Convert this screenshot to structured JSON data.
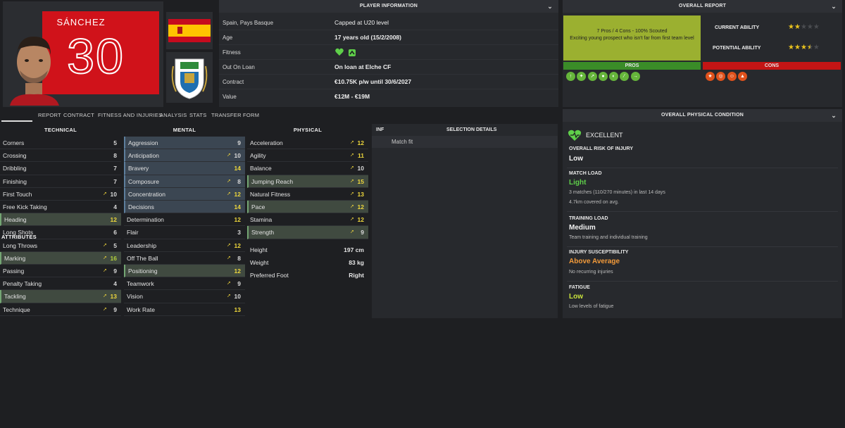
{
  "player": {
    "name": "SÁNCHEZ",
    "number": "30"
  },
  "info": {
    "title": "PLAYER INFORMATION",
    "rows": [
      {
        "key": "Spain, Pays Basque",
        "value": "Capped at U20 level",
        "bold": false
      },
      {
        "key": "Age",
        "value": "17 years old (15/2/2008)",
        "bold": true
      },
      {
        "key": "Fitness",
        "value": "",
        "bold": false
      },
      {
        "key": "Out On Loan",
        "value": "On loan at Elche CF",
        "bold": true
      },
      {
        "key": "Contract",
        "value": "€10.75K p/w until 30/6/2027",
        "bold": true
      },
      {
        "key": "Value",
        "value": "€12M - €19M",
        "bold": true
      }
    ]
  },
  "tabs": [
    "ATTRIBUTES",
    "REPORT",
    "CONTRACT",
    "FITNESS AND INJURIES",
    "ANALYSIS",
    "STATS",
    "TRANSFER",
    "FORM"
  ],
  "attributes": {
    "technical": {
      "title": "TECHNICAL",
      "rows": [
        {
          "n": "Corners",
          "v": "5",
          "arrow": false,
          "hl": "",
          "c": "w"
        },
        {
          "n": "Crossing",
          "v": "8",
          "arrow": false,
          "hl": "",
          "c": "w"
        },
        {
          "n": "Dribbling",
          "v": "7",
          "arrow": false,
          "hl": "",
          "c": "w"
        },
        {
          "n": "Finishing",
          "v": "7",
          "arrow": false,
          "hl": "",
          "c": "w"
        },
        {
          "n": "First Touch",
          "v": "10",
          "arrow": true,
          "hl": "",
          "c": "w"
        },
        {
          "n": "Free Kick Taking",
          "v": "4",
          "arrow": false,
          "hl": "",
          "c": "w"
        },
        {
          "n": "Heading",
          "v": "12",
          "arrow": false,
          "hl": "g",
          "c": "y"
        },
        {
          "n": "Long Shots",
          "v": "6",
          "arrow": false,
          "hl": "",
          "c": "w"
        },
        {
          "n": "Long Throws",
          "v": "5",
          "arrow": true,
          "hl": "",
          "c": "w"
        },
        {
          "n": "Marking",
          "v": "16",
          "arrow": true,
          "hl": "g",
          "c": "g"
        },
        {
          "n": "Passing",
          "v": "9",
          "arrow": true,
          "hl": "",
          "c": "w"
        },
        {
          "n": "Penalty Taking",
          "v": "4",
          "arrow": false,
          "hl": "",
          "c": "w"
        },
        {
          "n": "Tackling",
          "v": "13",
          "arrow": true,
          "hl": "g",
          "c": "y"
        },
        {
          "n": "Technique",
          "v": "9",
          "arrow": true,
          "hl": "",
          "c": "w"
        }
      ]
    },
    "mental": {
      "title": "MENTAL",
      "rows": [
        {
          "n": "Aggression",
          "v": "9",
          "arrow": false,
          "hl": "b",
          "c": "w"
        },
        {
          "n": "Anticipation",
          "v": "10",
          "arrow": true,
          "hl": "b",
          "c": "w"
        },
        {
          "n": "Bravery",
          "v": "14",
          "arrow": false,
          "hl": "b",
          "c": "y"
        },
        {
          "n": "Composure",
          "v": "8",
          "arrow": true,
          "hl": "b",
          "c": "w"
        },
        {
          "n": "Concentration",
          "v": "12",
          "arrow": true,
          "hl": "b",
          "c": "y"
        },
        {
          "n": "Decisions",
          "v": "14",
          "arrow": false,
          "hl": "b",
          "c": "y"
        },
        {
          "n": "Determination",
          "v": "12",
          "arrow": false,
          "hl": "",
          "c": "y"
        },
        {
          "n": "Flair",
          "v": "3",
          "arrow": false,
          "hl": "",
          "c": "w"
        },
        {
          "n": "Leadership",
          "v": "12",
          "arrow": true,
          "hl": "",
          "c": "y"
        },
        {
          "n": "Off The Ball",
          "v": "8",
          "arrow": true,
          "hl": "",
          "c": "w"
        },
        {
          "n": "Positioning",
          "v": "12",
          "arrow": false,
          "hl": "g",
          "c": "y"
        },
        {
          "n": "Teamwork",
          "v": "9",
          "arrow": true,
          "hl": "",
          "c": "w"
        },
        {
          "n": "Vision",
          "v": "10",
          "arrow": true,
          "hl": "",
          "c": "w"
        },
        {
          "n": "Work Rate",
          "v": "13",
          "arrow": false,
          "hl": "",
          "c": "y"
        }
      ]
    },
    "physical": {
      "title": "PHYSICAL",
      "rows": [
        {
          "n": "Acceleration",
          "v": "12",
          "arrow": true,
          "hl": "",
          "c": "y"
        },
        {
          "n": "Agility",
          "v": "11",
          "arrow": true,
          "hl": "",
          "c": "y"
        },
        {
          "n": "Balance",
          "v": "10",
          "arrow": true,
          "hl": "",
          "c": "w"
        },
        {
          "n": "Jumping Reach",
          "v": "15",
          "arrow": true,
          "hl": "g",
          "c": "y"
        },
        {
          "n": "Natural Fitness",
          "v": "13",
          "arrow": true,
          "hl": "",
          "c": "y"
        },
        {
          "n": "Pace",
          "v": "12",
          "arrow": true,
          "hl": "g",
          "c": "y"
        },
        {
          "n": "Stamina",
          "v": "12",
          "arrow": true,
          "hl": "",
          "c": "y"
        },
        {
          "n": "Strength",
          "v": "9",
          "arrow": true,
          "hl": "g",
          "c": "w"
        }
      ]
    },
    "physical_info": [
      {
        "n": "Height",
        "v": "197 cm"
      },
      {
        "n": "Weight",
        "v": "83 kg"
      },
      {
        "n": "Preferred Foot",
        "v": "Right"
      }
    ]
  },
  "selection": {
    "inf": "INF",
    "title": "SELECTION DETAILS",
    "match_fit": "Match fit"
  },
  "report": {
    "title": "OVERALL REPORT",
    "scout_line1": "7 Pros / 4 Cons - 100% Scouted",
    "scout_line2": "Exciting young prospect who isn't far from first team level",
    "current_ability": "CURRENT ABILITY",
    "potential_ability": "POTENTIAL ABILITY",
    "ca_stars": 2,
    "pa_stars": 3.5,
    "pros": "PROS",
    "cons": "CONS",
    "pros_count": 7,
    "cons_count": 4
  },
  "condition": {
    "title": "OVERALL PHYSICAL CONDITION",
    "status": "EXCELLENT",
    "risk_title": "OVERALL RISK OF INJURY",
    "risk_value": "Low",
    "load_title": "MATCH LOAD",
    "load_value": "Light",
    "load_sub1": "3 matches (110/270 minutes) in last 14 days",
    "load_sub2": "4.7km covered on avg.",
    "training_title": "TRAINING LOAD",
    "training_value": "Medium",
    "training_sub": "Team training and individual training",
    "susc_title": "INJURY SUSCEPTIBILITY",
    "susc_value": "Above Average",
    "susc_sub": "No recurring injuries",
    "fatigue_title": "FATIGUE",
    "fatigue_value": "Low",
    "fatigue_sub": "Low levels of fatigue"
  },
  "colors": {
    "accent_green": "#5fcf4a",
    "orange": "#f29a3a",
    "red": "#c41515",
    "yellow": "#eed73c"
  }
}
